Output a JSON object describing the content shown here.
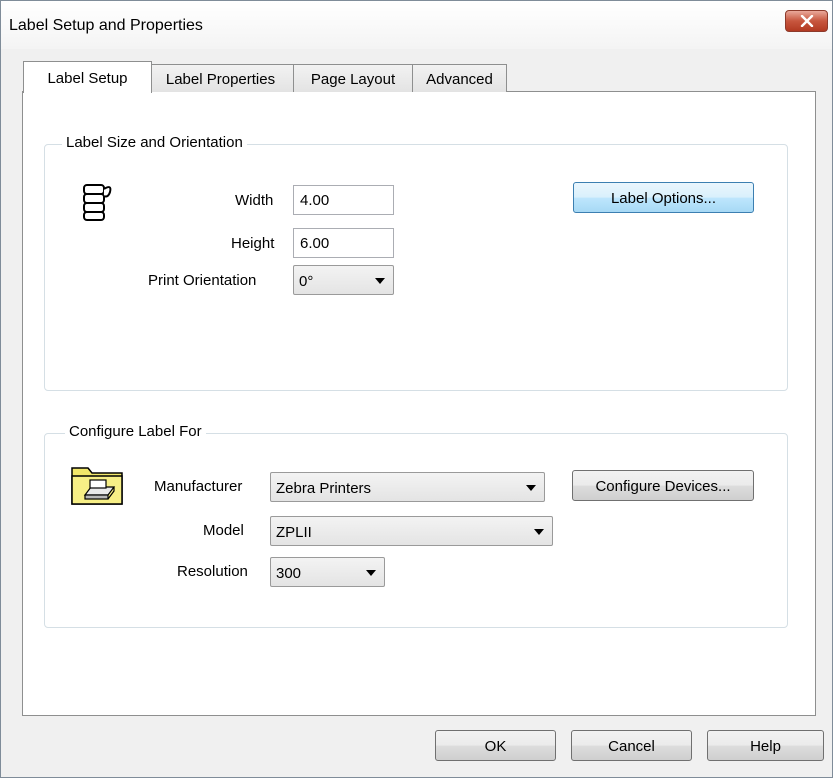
{
  "window": {
    "title": "Label Setup and Properties"
  },
  "tabs": [
    {
      "label": "Label Setup",
      "active": true
    },
    {
      "label": "Label Properties",
      "active": false
    },
    {
      "label": "Page Layout",
      "active": false
    },
    {
      "label": "Advanced",
      "active": false
    }
  ],
  "size_group": {
    "title": "Label Size and Orientation",
    "width_label": "Width",
    "width_value": "4.00",
    "height_label": "Height",
    "height_value": "6.00",
    "orientation_label": "Print Orientation",
    "orientation_value": "0°",
    "label_options_button": "Label Options..."
  },
  "config_group": {
    "title": "Configure Label For",
    "manufacturer_label": "Manufacturer",
    "manufacturer_value": "Zebra Printers",
    "configure_devices_button": "Configure Devices...",
    "model_label": "Model",
    "model_value": "ZPLII",
    "resolution_label": "Resolution",
    "resolution_value": "300"
  },
  "footer": {
    "ok": "OK",
    "cancel": "Cancel",
    "help": "Help"
  },
  "icons": {
    "close": "close-icon",
    "label_stack": "label-stack-icon",
    "printer_folder": "printer-folder-icon"
  }
}
